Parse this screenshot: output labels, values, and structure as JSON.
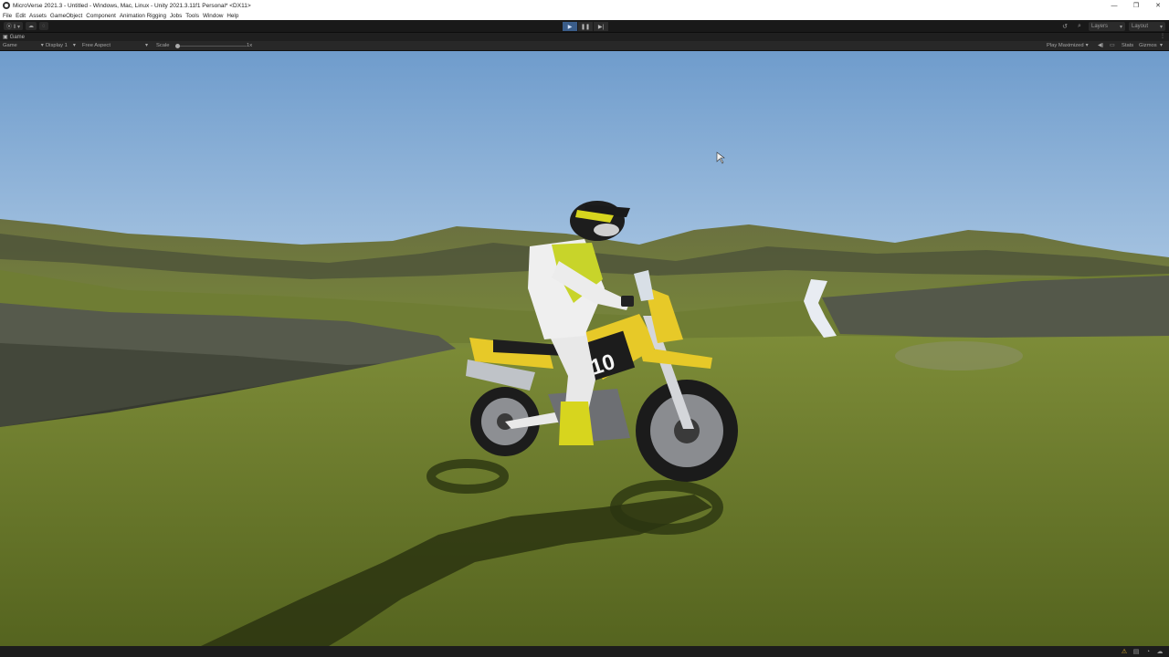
{
  "window": {
    "title": "MicroVerse 2021.3 - Untitled - Windows, Mac, Linux - Unity 2021.3.11f1 Personal* <DX11>",
    "controls": [
      "—",
      "❐",
      "✕"
    ]
  },
  "menu": [
    "File",
    "Edit",
    "Assets",
    "GameObject",
    "Component",
    "Animation Rigging",
    "Jobs",
    "Tools",
    "Window",
    "Help"
  ],
  "toolbar": {
    "account_label": "⦿ ll ▾",
    "cloud_icon": "cloud-icon",
    "play_icon": "play-icon",
    "pause_icon": "pause-icon",
    "step_icon": "step-icon",
    "layers_label": "Layers",
    "layout_label": "Layout",
    "accent": "#3a5d8a"
  },
  "tab": {
    "label": "Game"
  },
  "game_view": {
    "display_mode": "Game",
    "display": "Display 1",
    "aspect": "Free Aspect",
    "scale_label": "Scale",
    "scale_value": "1x",
    "play_mode": "Play Maximized",
    "stats_label": "Stats",
    "gizmos_label": "Gizmos"
  },
  "scene": {
    "description_icons": [
      "rider-figure",
      "motorcycle",
      "checkpoint-arrow"
    ],
    "bike_number": "10",
    "colors": {
      "sky_top": "#6f9ccc",
      "sky_bottom": "#b3cde6",
      "grass": "#6f7f2c",
      "grass_dark": "#4d5a1c",
      "rock": "#565a4c",
      "bike_yellow": "#e7c928"
    }
  },
  "status": {
    "icons": [
      "warning-icon",
      "console-icon",
      "progress-icon",
      "cloud-status-icon"
    ]
  }
}
